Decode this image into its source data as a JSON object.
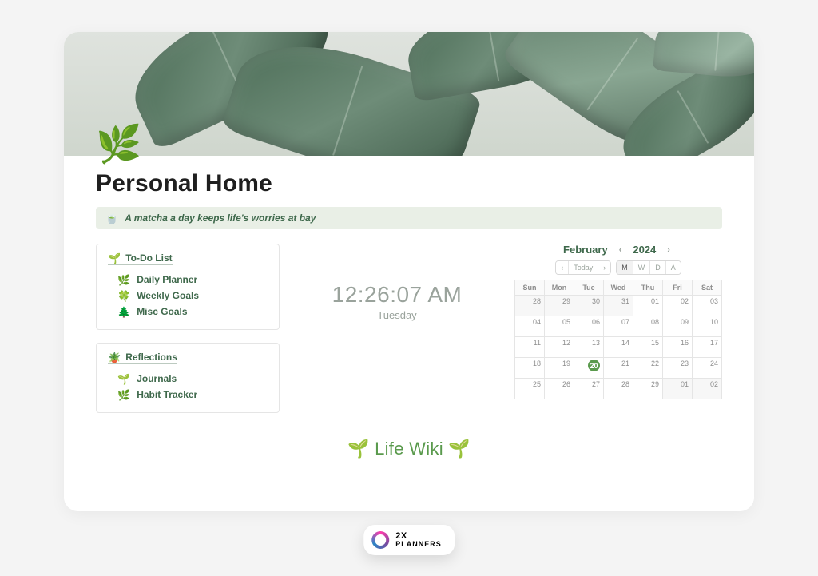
{
  "page": {
    "icon": "🌿",
    "title": "Personal Home"
  },
  "quote": {
    "icon": "🍵",
    "text": "A matcha a day keeps life's worries at bay"
  },
  "sidebar": {
    "todo": {
      "icon": "🌱",
      "title": "To-Do List",
      "items": [
        {
          "icon": "🌿",
          "label": "Daily Planner"
        },
        {
          "icon": "🍀",
          "label": "Weekly Goals"
        },
        {
          "icon": "🌲",
          "label": "Misc Goals"
        }
      ]
    },
    "reflections": {
      "icon": "🪴",
      "title": "Reflections",
      "items": [
        {
          "icon": "🌱",
          "label": "Journals"
        },
        {
          "icon": "🌿",
          "label": "Habit Tracker"
        }
      ]
    }
  },
  "clock": {
    "time": "12:26:07 AM",
    "day": "Tuesday"
  },
  "calendar": {
    "month": "February",
    "year": "2024",
    "today_button": "Today",
    "views": [
      "M",
      "W",
      "D",
      "A"
    ],
    "selected_view": "M",
    "weekdays": [
      "Sun",
      "Mon",
      "Tue",
      "Wed",
      "Thu",
      "Fri",
      "Sat"
    ],
    "today": 20,
    "grid": [
      [
        {
          "d": 28,
          "o": true
        },
        {
          "d": 29,
          "o": true
        },
        {
          "d": 30,
          "o": true
        },
        {
          "d": 31,
          "o": true
        },
        {
          "d": "01"
        },
        {
          "d": "02"
        },
        {
          "d": "03"
        }
      ],
      [
        {
          "d": "04"
        },
        {
          "d": "05"
        },
        {
          "d": "06"
        },
        {
          "d": "07"
        },
        {
          "d": "08"
        },
        {
          "d": "09"
        },
        {
          "d": 10
        }
      ],
      [
        {
          "d": 11
        },
        {
          "d": 12
        },
        {
          "d": 13
        },
        {
          "d": 14
        },
        {
          "d": 15
        },
        {
          "d": 16
        },
        {
          "d": 17
        }
      ],
      [
        {
          "d": 18
        },
        {
          "d": 19
        },
        {
          "d": 20
        },
        {
          "d": 21
        },
        {
          "d": 22
        },
        {
          "d": 23
        },
        {
          "d": 24
        }
      ],
      [
        {
          "d": 25
        },
        {
          "d": 26
        },
        {
          "d": 27
        },
        {
          "d": 28
        },
        {
          "d": 29
        },
        {
          "d": "01",
          "o": true
        },
        {
          "d": "02",
          "o": true
        }
      ]
    ]
  },
  "footer": {
    "label": "Life Wiki",
    "icon": "🌱"
  },
  "badge": {
    "line1": "2X",
    "line2": "PLANNERS"
  }
}
